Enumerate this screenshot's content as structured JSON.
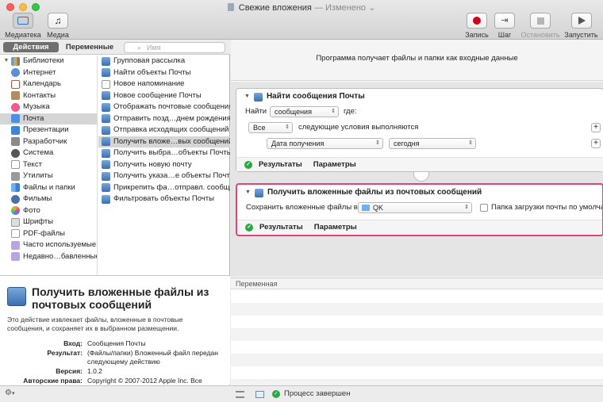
{
  "window": {
    "title": "Свежие вложения",
    "title_separator": "—",
    "edited": "Изменено"
  },
  "toolbar": {
    "left": [
      {
        "label": "Медиатека",
        "icon": "library-icon"
      },
      {
        "label": "Медиа",
        "icon": "media-icon"
      }
    ],
    "right": [
      {
        "label": "Запись",
        "icon": "record-icon"
      },
      {
        "label": "Шаг",
        "icon": "step-icon"
      },
      {
        "label": "Остановить",
        "icon": "stop-icon"
      },
      {
        "label": "Запустить",
        "icon": "run-icon"
      }
    ]
  },
  "left_tabs": {
    "actions": "Действия",
    "variables": "Переменные",
    "search_placeholder": "Имя"
  },
  "library": {
    "root": "Библиотеки",
    "items": [
      "Интернет",
      "Календарь",
      "Контакты",
      "Музыка",
      "Почта",
      "Презентации",
      "Разработчик",
      "Система",
      "Текст",
      "Утилиты",
      "Файлы и папки",
      "Фильмы",
      "Фото",
      "Шрифты",
      "PDF-файлы"
    ],
    "selected": "Почта",
    "extra": [
      "Часто используемые",
      "Недавно…бавленные"
    ]
  },
  "actions_list": {
    "items": [
      "Групповая рассылка",
      "Найти объекты Почты",
      "Новое напоминание",
      "Новое сообщение Почты",
      "Отображать почтовые сообщения",
      "Отправить позд…днем рождения",
      "Отправка исходящих сообщений",
      "Получить вложе…вых сообщений",
      "Получить выбра…объекты Почты",
      "Получить новую почту",
      "Получить указа…е объекты Почты",
      "Прикрепить фа…отправл. сообщ.",
      "Фильтровать объекты Почты"
    ],
    "selected": "Получить вложе…вых сообщений"
  },
  "description": {
    "title": "Получить вложенные файлы из почтовых сообщений",
    "text": "Это действие извлекает файлы, вложенные в почтовые сообщения, и сохраняет их в выбранном размещении.",
    "fields": [
      {
        "key": "Вход:",
        "value": "Сообщения Почты"
      },
      {
        "key": "Результат:",
        "value": "(Файлы/папки) Вложенный файл передан следующему действию"
      },
      {
        "key": "Версия:",
        "value": "1.0.2"
      },
      {
        "key": "Авторские права:",
        "value": "Copyright © 2007-2012 Apple Inc. Все"
      }
    ]
  },
  "workflow": {
    "banner": "Программа получает файлы и папки как входные данные",
    "card1": {
      "title": "Найти сообщения Почты",
      "find_label": "Найти",
      "find_value": "сообщения",
      "where_label": "где:",
      "all_value": "Все",
      "conditions_text": "следующие условия выполняются",
      "criterion": "Дата получения",
      "criterion_value": "сегодня",
      "results": "Результаты",
      "options": "Параметры"
    },
    "card2": {
      "title": "Получить вложенные файлы из почтовых сообщений",
      "save_label": "Сохранить вложенные файлы в:",
      "folder": "QK",
      "checkbox_label": "Папка загрузки почты по умолчанию",
      "results": "Результаты",
      "options": "Параметры"
    }
  },
  "variables_header": "Переменная",
  "status": {
    "text": "Процесс завершен"
  },
  "colors": {
    "selection_border": "#e0457a",
    "record_red": "#d0021b",
    "success_green": "#28a745"
  }
}
